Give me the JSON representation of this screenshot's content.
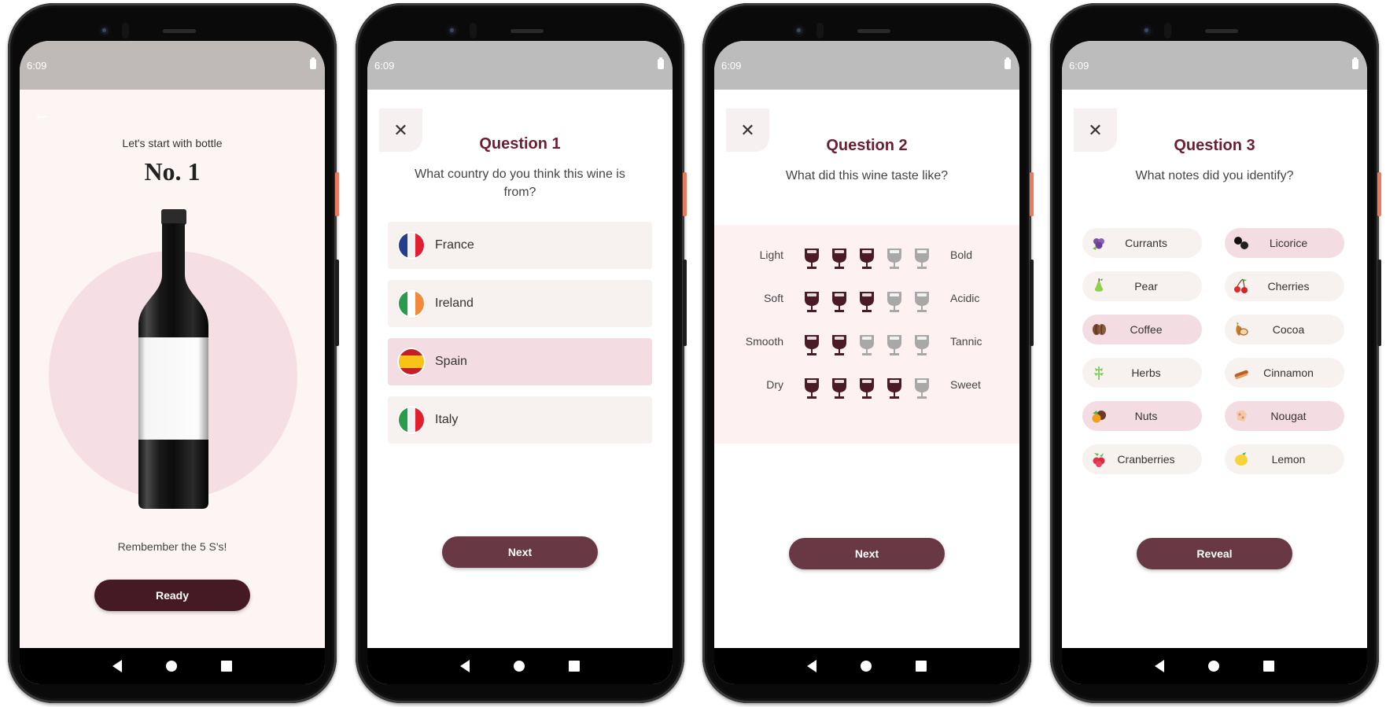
{
  "status_bar": {
    "time": "6:09"
  },
  "screen1": {
    "intro": "Let's start with bottle",
    "bottle_number": "No. 1",
    "reminder": "Rembember the 5 S's!",
    "ready_label": "Ready"
  },
  "screen2": {
    "title": "Question 1",
    "prompt": "What country do you think this wine is from?",
    "options": [
      {
        "label": "France",
        "flag": [
          "#243d8c",
          "#f1f1f3",
          "#e0202f"
        ],
        "dir": "v",
        "selected": false
      },
      {
        "label": "Ireland",
        "flag": [
          "#2a9a4c",
          "#ffffff",
          "#f08a3c"
        ],
        "dir": "v",
        "selected": false
      },
      {
        "label": "Spain",
        "flag": [
          "#c41e26",
          "#f7c31a",
          "#c41e26"
        ],
        "dir": "h",
        "selected": true
      },
      {
        "label": "Italy",
        "flag": [
          "#2a9a4c",
          "#f1f1f3",
          "#e0202f"
        ],
        "dir": "v",
        "selected": false
      }
    ],
    "next_label": "Next"
  },
  "screen3": {
    "title": "Question 2",
    "prompt": "What did this wine taste like?",
    "scale_max": 5,
    "rows": [
      {
        "left": "Light",
        "right": "Bold",
        "value": 3
      },
      {
        "left": "Soft",
        "right": "Acidic",
        "value": 3
      },
      {
        "left": "Smooth",
        "right": "Tannic",
        "value": 2
      },
      {
        "left": "Dry",
        "right": "Sweet",
        "value": 4
      }
    ],
    "next_label": "Next"
  },
  "screen4": {
    "title": "Question 3",
    "prompt": "What notes did you identify?",
    "notes": [
      {
        "label": "Currants",
        "icon": "currants-icon",
        "selected": false
      },
      {
        "label": "Licorice",
        "icon": "licorice-icon",
        "selected": true
      },
      {
        "label": "Pear",
        "icon": "pear-icon",
        "selected": false
      },
      {
        "label": "Cherries",
        "icon": "cherries-icon",
        "selected": false
      },
      {
        "label": "Coffee",
        "icon": "coffee-bean-icon",
        "selected": true
      },
      {
        "label": "Cocoa",
        "icon": "cocoa-icon",
        "selected": false
      },
      {
        "label": "Herbs",
        "icon": "herbs-icon",
        "selected": false
      },
      {
        "label": "Cinnamon",
        "icon": "cinnamon-icon",
        "selected": false
      },
      {
        "label": "Nuts",
        "icon": "nuts-icon",
        "selected": true
      },
      {
        "label": "Nougat",
        "icon": "nougat-icon",
        "selected": true
      },
      {
        "label": "Cranberries",
        "icon": "cranberries-icon",
        "selected": false
      },
      {
        "label": "Lemon",
        "icon": "lemon-icon",
        "selected": false
      }
    ],
    "reveal_label": "Reveal"
  },
  "colors": {
    "accent_dark": "#461a25",
    "accent": "#683844",
    "title": "#6b1f33",
    "selected_bg": "#f4dde2",
    "option_bg": "#f7f1ef",
    "glass_filled": "#4a1a26",
    "glass_empty": "#a8a8a8"
  }
}
